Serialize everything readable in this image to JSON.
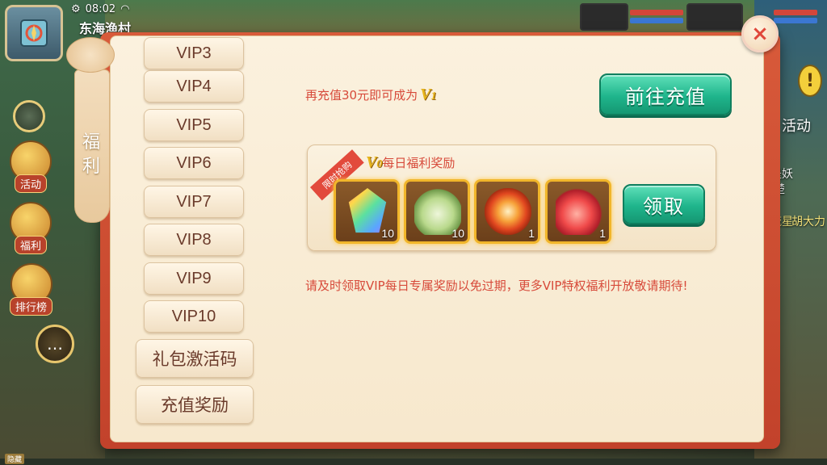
{
  "status": {
    "time": "08:02"
  },
  "hud": {
    "location": "东海渔村",
    "side_buttons": [
      {
        "label": "活动"
      },
      {
        "label": "福利"
      },
      {
        "label": "排行榜"
      }
    ],
    "right_label": "活动",
    "right_notes": [
      "是妖",
      "楚",
      "流星",
      "胡大力"
    ],
    "excl": "!",
    "bottom_tag": "隐藏"
  },
  "dialog": {
    "tab_label": "福\n利",
    "menu": [
      "VIP3",
      "VIP4",
      "VIP5",
      "VIP6",
      "VIP7",
      "VIP8",
      "VIP9",
      "VIP10",
      "礼包激活码",
      "充值奖励"
    ],
    "recharge_tip": "再充值30元即可成为",
    "next_vip": {
      "prefix": "V",
      "level": "1"
    },
    "goto_button": "前往充值",
    "reward": {
      "limited_tag": "限时抢购",
      "vip": {
        "prefix": "V",
        "level": "0"
      },
      "title": "每日福利奖励",
      "items": [
        {
          "name": "rainbow-crystal-icon",
          "qty": "10"
        },
        {
          "name": "lotus-icon",
          "qty": "10"
        },
        {
          "name": "golden-orb-icon",
          "qty": "1"
        },
        {
          "name": "red-feather-icon",
          "qty": "1"
        }
      ],
      "claim_button": "领取"
    },
    "notice": "请及时领取VIP每日专属奖励以免过期，更多VIP特权福利开放敬请期待!",
    "close": "×"
  },
  "colors": {
    "accent_red": "#d74a3a",
    "button_green": "#1fb58c",
    "gold": "#e7b51d",
    "frame": "#c2422b"
  }
}
